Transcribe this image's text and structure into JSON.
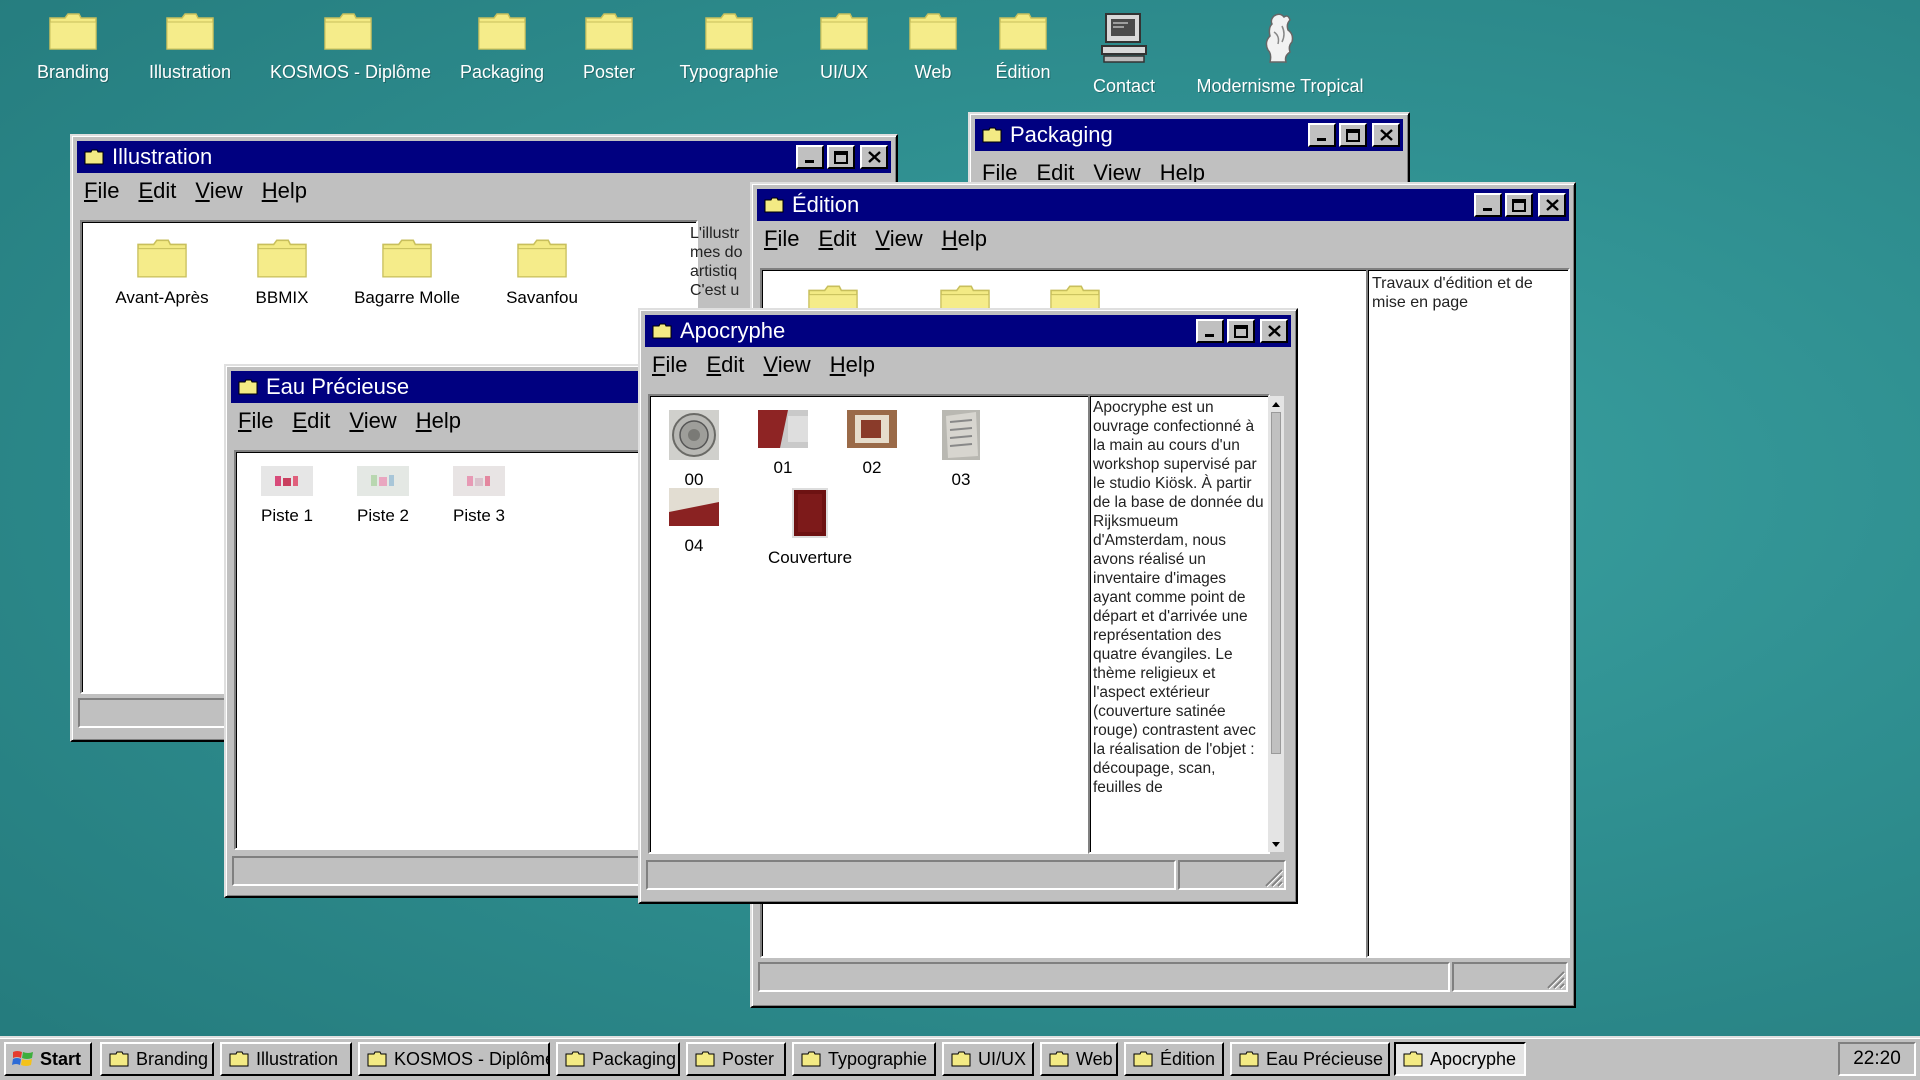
{
  "desktop": {
    "icons": [
      {
        "label": "Branding",
        "icon": "folder-icon"
      },
      {
        "label": "Illustration",
        "icon": "folder-icon"
      },
      {
        "label": "KOSMOS - Diplôme",
        "icon": "folder-icon"
      },
      {
        "label": "Packaging",
        "icon": "folder-icon"
      },
      {
        "label": "Poster",
        "icon": "folder-icon"
      },
      {
        "label": "Typographie",
        "icon": "folder-icon"
      },
      {
        "label": "UI/UX",
        "icon": "folder-icon"
      },
      {
        "label": "Web",
        "icon": "folder-icon"
      },
      {
        "label": "Édition",
        "icon": "folder-icon"
      },
      {
        "label": "Contact",
        "icon": "computer-icon"
      },
      {
        "label": "Modernisme Tropical",
        "icon": "sculpture-icon"
      }
    ]
  },
  "menu": {
    "file": "File",
    "edit": "Edit",
    "view": "View",
    "help": "Help"
  },
  "windows": {
    "illustration": {
      "title": "Illustration",
      "items": [
        "Avant-Après",
        "BBMIX",
        "Bagarre Molle",
        "Savanfou"
      ],
      "side_text": "L'illustr mes do artistiq C'est u"
    },
    "packaging": {
      "title": "Packaging"
    },
    "edition": {
      "title": "Édition",
      "side_text": "Travaux d'édition et de mise en page"
    },
    "eau_precieuse": {
      "title": "Eau Précieuse",
      "items": [
        "Piste 1",
        "Piste 2",
        "Piste 3"
      ]
    },
    "apocryphe": {
      "title": "Apocryphe",
      "items": [
        "00",
        "01",
        "02",
        "03",
        "04",
        "Couverture"
      ],
      "side_text": "Apocryphe est un ouvrage confectionné à la main au cours d'un workshop supervisé par le studio Kiösk. À partir de la base de donnée du Rijksmueum d'Amsterdam, nous avons réalisé un inventaire d'images ayant comme point de départ et d'arrivée une représentation des quatre évangiles. Le thème religieux et l'aspect extérieur (couverture satinée rouge) contrastent avec la réalisation de l'objet : découpage, scan, feuilles de"
    }
  },
  "taskbar": {
    "start": "Start",
    "buttons": [
      "Branding",
      "Illustration",
      "KOSMOS - Diplôme",
      "Packaging",
      "Poster",
      "Typographie",
      "UI/UX",
      "Web",
      "Édition",
      "Eau Précieuse",
      "Apocryphe"
    ],
    "active": "Apocryphe",
    "clock": "22:20"
  },
  "colors": {
    "desktop": "#2f8f90",
    "titlebar": "#000080",
    "folder": "#f3ea84",
    "window": "#c0c0c0"
  }
}
